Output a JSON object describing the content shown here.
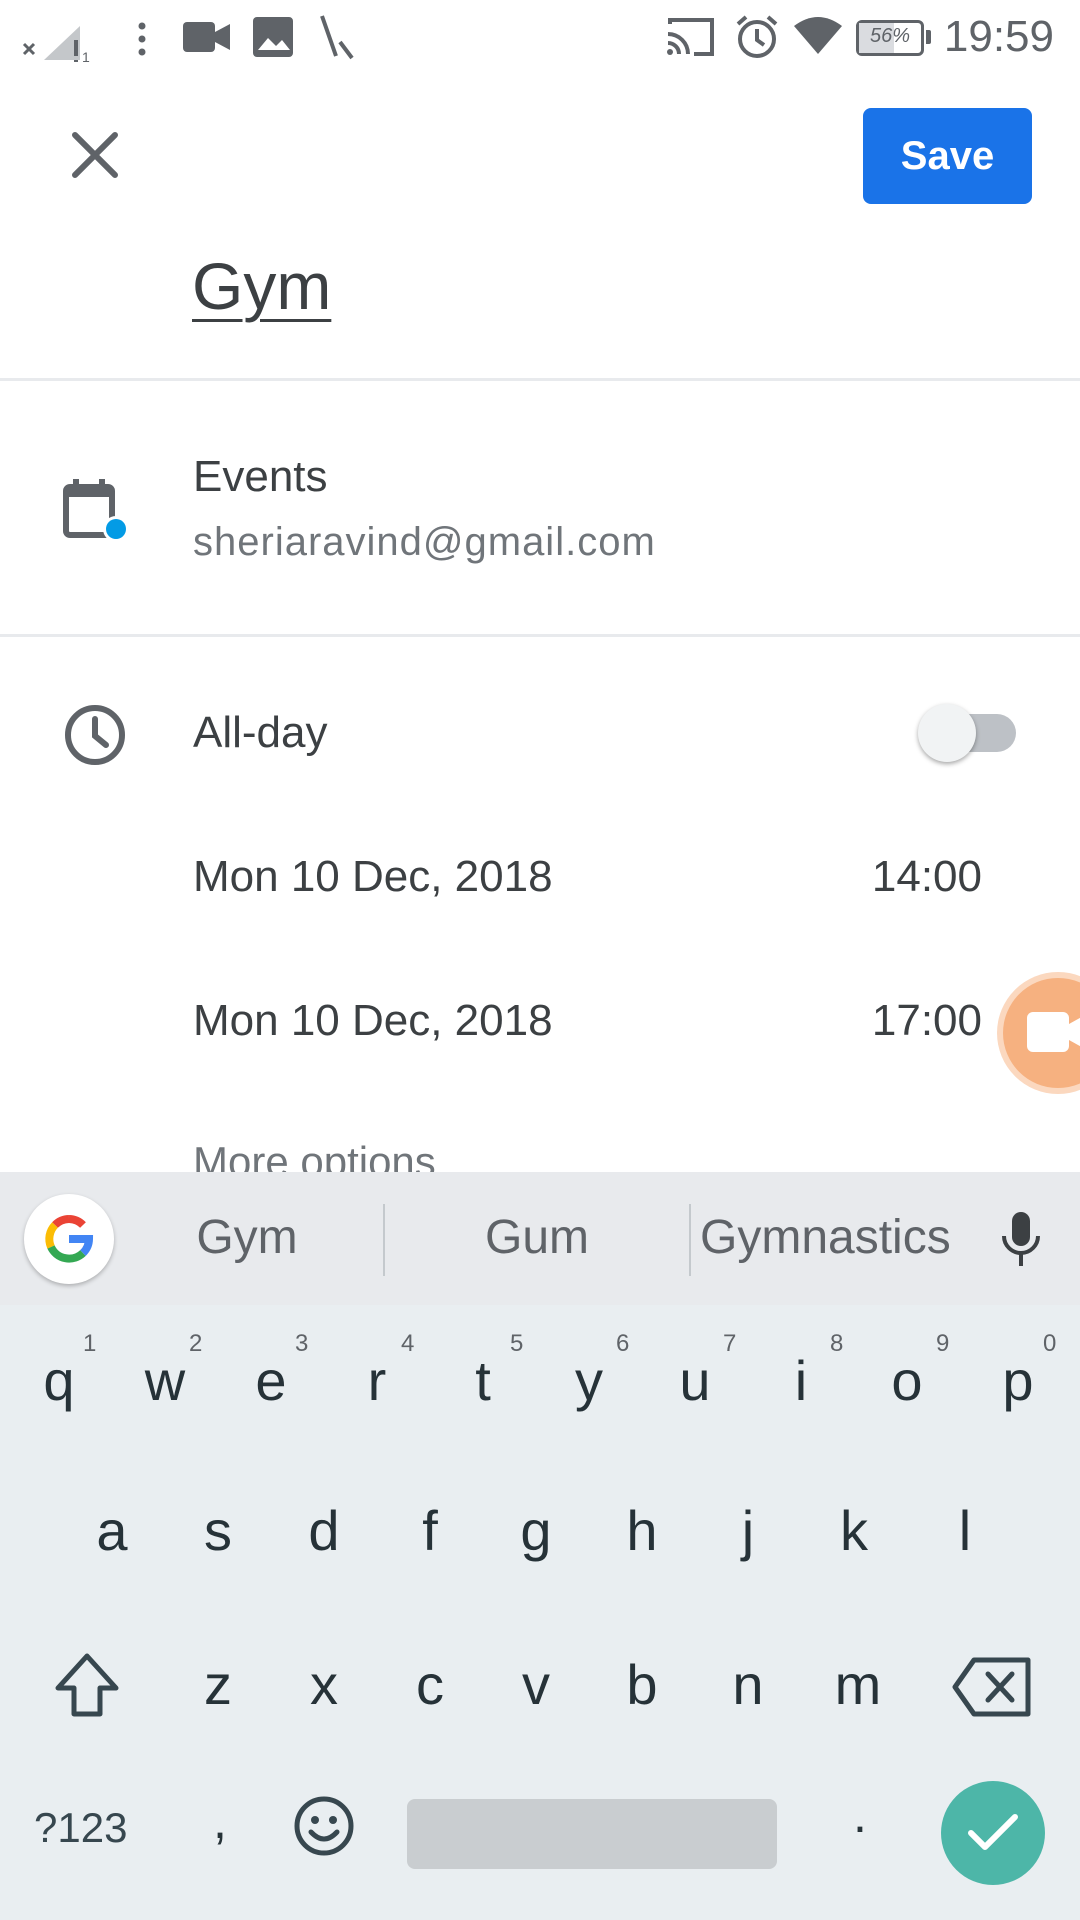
{
  "status_bar": {
    "time": "19:59",
    "battery": "56%",
    "icons": [
      "signal-off-icon",
      "more-vert-icon",
      "video-icon",
      "image-icon",
      "cursor-icon",
      "cast-icon",
      "alarm-icon",
      "wifi-icon",
      "battery-icon"
    ]
  },
  "toolbar": {
    "save_label": "Save"
  },
  "event": {
    "title": "Gym",
    "calendar_name": "Events",
    "account": "sheriaravind@gmail.com",
    "all_day_label": "All-day",
    "all_day_on": false,
    "start_date": "Mon 10 Dec, 2018",
    "start_time": "14:00",
    "end_date": "Mon 10 Dec, 2018",
    "end_time": "17:00",
    "more_options": "More options"
  },
  "colors": {
    "accent": "#1a73e8",
    "calendar_dot": "#039be5",
    "fab": "#f6b180",
    "enter_key": "#4db6a8"
  },
  "keyboard": {
    "suggestions": [
      "Gym",
      "Gum",
      "Gymnastics"
    ],
    "row1": [
      "q",
      "w",
      "e",
      "r",
      "t",
      "y",
      "u",
      "i",
      "o",
      "p"
    ],
    "row1_hints": [
      "1",
      "2",
      "3",
      "4",
      "5",
      "6",
      "7",
      "8",
      "9",
      "0"
    ],
    "row2": [
      "a",
      "s",
      "d",
      "f",
      "g",
      "h",
      "j",
      "k",
      "l"
    ],
    "row3": [
      "z",
      "x",
      "c",
      "v",
      "b",
      "n",
      "m"
    ],
    "symbols_label": "?123",
    "comma": ",",
    "period": "."
  }
}
